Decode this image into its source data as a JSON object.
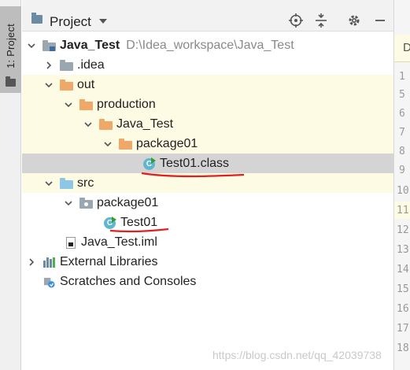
{
  "side_stripe": {
    "label": "1: Project"
  },
  "panel": {
    "title": "Project"
  },
  "tree": {
    "root": {
      "name": "Java_Test",
      "path": "D:\\Idea_workspace\\Java_Test"
    },
    "idea": ".idea",
    "out": "out",
    "production": "production",
    "java_test": "Java_Test",
    "package_out": "package01",
    "class_file": "Test01.class",
    "src": "src",
    "package_src": "package01",
    "test_class": "Test01",
    "iml": "Java_Test.iml",
    "external": "External Libraries",
    "scratches": "Scratches and Consoles"
  },
  "editor": {
    "tab_letter": "D",
    "line_numbers": [
      "1",
      "5",
      "6",
      "7",
      "8",
      "9",
      "10",
      "11",
      "12",
      "13",
      "14",
      "15",
      "16",
      "17",
      "18"
    ]
  },
  "watermark": "https://blog.csdn.net/qq_42039738",
  "colors": {
    "selection": "#d4d4d4",
    "yellow_highlight": "#fdfbe3",
    "excluded_folder": "#f0a868",
    "source_folder": "#8ec7e6",
    "annotation_red": "#e02020"
  }
}
